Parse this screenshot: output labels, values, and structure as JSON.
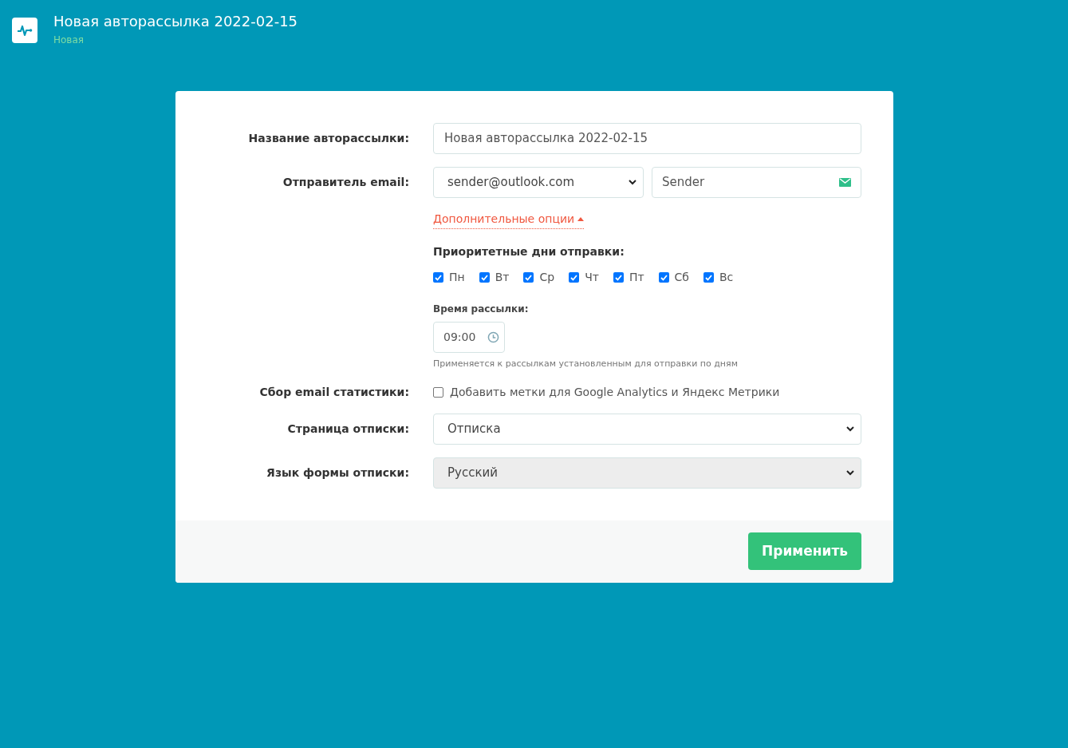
{
  "header": {
    "title": "Новая авторассылка 2022-02-15",
    "status": "Новая"
  },
  "form": {
    "name": {
      "label": "Название авторассылки:",
      "value": "Новая авторассылка 2022-02-15"
    },
    "sender": {
      "label": "Отправитель email:",
      "email": "sender@outlook.com",
      "name": "Sender"
    },
    "more_options": {
      "label": "Дополнительные опции",
      "expanded": true
    },
    "priority_days": {
      "label": "Приоритетные дни отправки:",
      "days": [
        {
          "label": "Пн",
          "checked": true
        },
        {
          "label": "Вт",
          "checked": true
        },
        {
          "label": "Ср",
          "checked": true
        },
        {
          "label": "Чт",
          "checked": true
        },
        {
          "label": "Пт",
          "checked": true
        },
        {
          "label": "Сб",
          "checked": true
        },
        {
          "label": "Вс",
          "checked": true
        }
      ]
    },
    "send_time": {
      "label": "Время рассылки:",
      "value": "09:00",
      "hint": "Применяется к рассылкам установленным для отправки по дням"
    },
    "stats": {
      "label": "Сбор email статистики:",
      "option": "Добавить метки для Google Analytics и Яндекс Метрики",
      "checked": false
    },
    "unsubscribe_page": {
      "label": "Страница отписки:",
      "value": "Отписка",
      "disabled": false
    },
    "unsubscribe_language": {
      "label": "Язык формы отписки:",
      "value": "Русский",
      "disabled": true
    }
  },
  "apply_button": "Применить"
}
